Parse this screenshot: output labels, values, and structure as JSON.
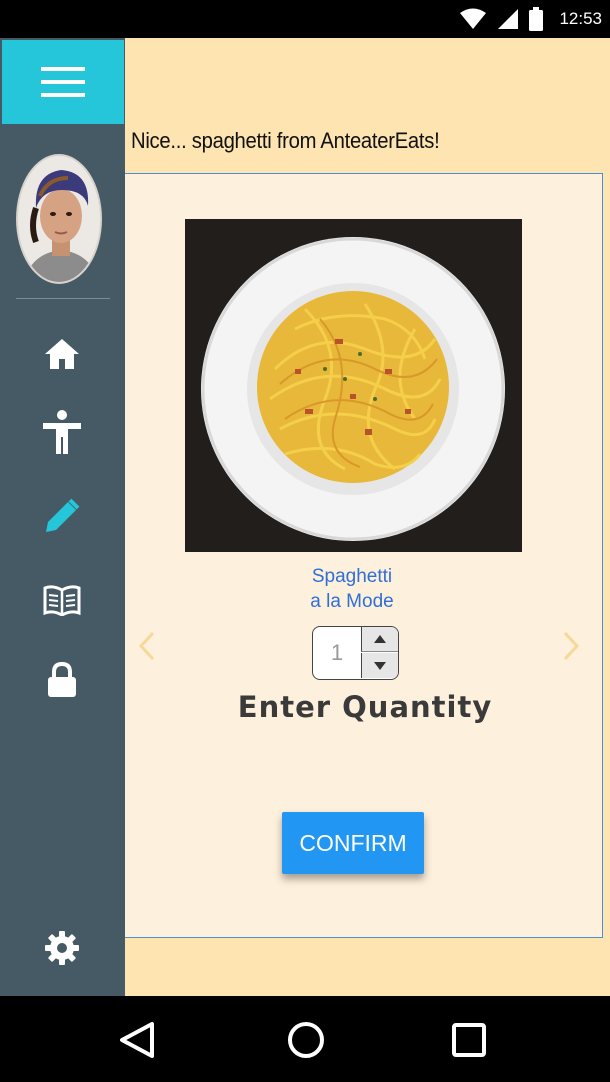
{
  "status_bar": {
    "time": "12:53"
  },
  "sidebar": {
    "items": [
      {
        "icon": "home-icon"
      },
      {
        "icon": "accessibility-icon"
      },
      {
        "icon": "pencil-icon",
        "active": true
      },
      {
        "icon": "book-icon"
      },
      {
        "icon": "lock-icon"
      },
      {
        "icon": "gear-icon"
      }
    ]
  },
  "header": {
    "message": "Nice... spaghetti from AnteaterEats!"
  },
  "item": {
    "name_line1": "Spaghetti",
    "name_line2": "a la Mode"
  },
  "quantity": {
    "value": "1",
    "label": "Enter Quantity"
  },
  "confirm": {
    "label": "CONFIRM"
  },
  "colors": {
    "accent": "#26c6da",
    "sidebar": "#455a64",
    "background": "#fde4b0",
    "button": "#2196f3",
    "link": "#2f6fd6"
  }
}
